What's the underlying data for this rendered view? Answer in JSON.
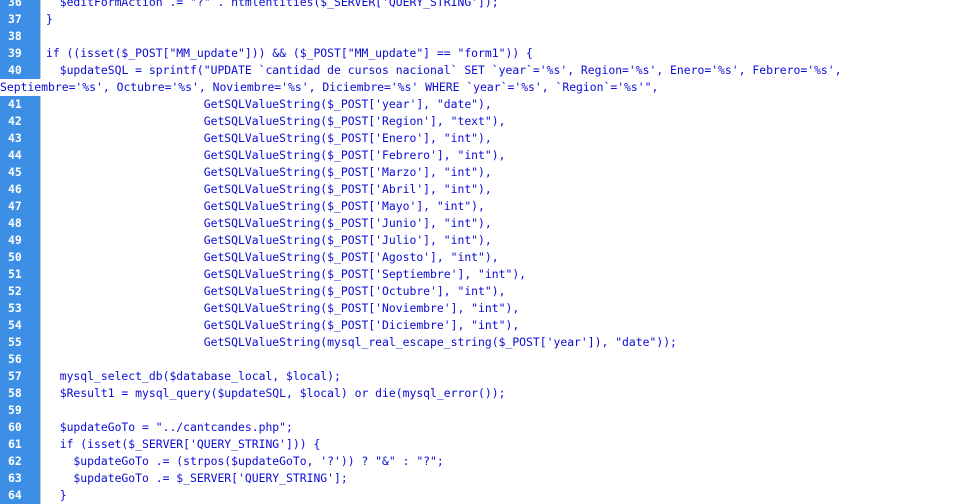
{
  "editor": {
    "lines": [
      {
        "num": "36",
        "text": "  $editFormAction .= \"?\" . htmlentities($_SERVER['QUERY_STRING']);"
      },
      {
        "num": "37",
        "text": "}"
      },
      {
        "num": "38",
        "text": ""
      },
      {
        "num": "39",
        "text": "if ((isset($_POST[\"MM_update\"])) && ($_POST[\"MM_update\"] == \"form1\")) {"
      },
      {
        "num": "40",
        "text": "  $updateSQL = sprintf(\"UPDATE `cantidad de cursos nacional` SET `year`='%s', Region='%s', Enero='%s', Febrero='%s',",
        "cont": "Septiembre='%s', Octubre='%s', Noviembre='%s', Diciembre='%s' WHERE `year`='%s', `Region`='%s'\","
      },
      {
        "num": "41",
        "text": "                       GetSQLValueString($_POST['year'], \"date\"),"
      },
      {
        "num": "42",
        "text": "                       GetSQLValueString($_POST['Region'], \"text\"),"
      },
      {
        "num": "43",
        "text": "                       GetSQLValueString($_POST['Enero'], \"int\"),"
      },
      {
        "num": "44",
        "text": "                       GetSQLValueString($_POST['Febrero'], \"int\"),"
      },
      {
        "num": "45",
        "text": "                       GetSQLValueString($_POST['Marzo'], \"int\"),"
      },
      {
        "num": "46",
        "text": "                       GetSQLValueString($_POST['Abril'], \"int\"),"
      },
      {
        "num": "47",
        "text": "                       GetSQLValueString($_POST['Mayo'], \"int\"),"
      },
      {
        "num": "48",
        "text": "                       GetSQLValueString($_POST['Junio'], \"int\"),"
      },
      {
        "num": "49",
        "text": "                       GetSQLValueString($_POST['Julio'], \"int\"),"
      },
      {
        "num": "50",
        "text": "                       GetSQLValueString($_POST['Agosto'], \"int\"),"
      },
      {
        "num": "51",
        "text": "                       GetSQLValueString($_POST['Septiembre'], \"int\"),"
      },
      {
        "num": "52",
        "text": "                       GetSQLValueString($_POST['Octubre'], \"int\"),"
      },
      {
        "num": "53",
        "text": "                       GetSQLValueString($_POST['Noviembre'], \"int\"),"
      },
      {
        "num": "54",
        "text": "                       GetSQLValueString($_POST['Diciembre'], \"int\"),"
      },
      {
        "num": "55",
        "text": "                       GetSQLValueString(mysql_real_escape_string($_POST['year']), \"date\"));"
      },
      {
        "num": "56",
        "text": ""
      },
      {
        "num": "57",
        "text": "  mysql_select_db($database_local, $local);"
      },
      {
        "num": "58",
        "text": "  $Result1 = mysql_query($updateSQL, $local) or die(mysql_error());"
      },
      {
        "num": "59",
        "text": ""
      },
      {
        "num": "60",
        "text": "  $updateGoTo = \"../cantcandes.php\";"
      },
      {
        "num": "61",
        "text": "  if (isset($_SERVER['QUERY_STRING'])) {"
      },
      {
        "num": "62",
        "text": "    $updateGoTo .= (strpos($updateGoTo, '?')) ? \"&\" : \"?\";"
      },
      {
        "num": "63",
        "text": "    $updateGoTo .= $_SERVER['QUERY_STRING'];"
      },
      {
        "num": "64",
        "text": "  }"
      }
    ]
  },
  "colors": {
    "code_text": "#0b0bd6",
    "gutter_bg": "#e0e0e0",
    "line_number_highlight": "#3d8fe6",
    "line_number_text": "#ffffff"
  }
}
